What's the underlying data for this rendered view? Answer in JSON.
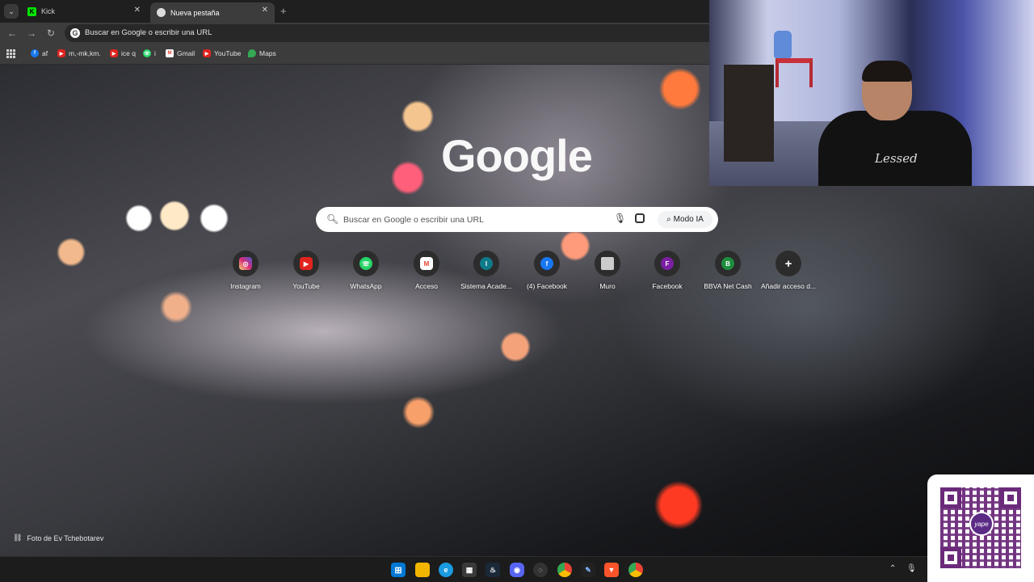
{
  "tabs": [
    {
      "title": "Kick",
      "active": false
    },
    {
      "title": "Nueva pestaña",
      "active": true
    }
  ],
  "omnibox": {
    "text": "Buscar en Google o escribir una URL"
  },
  "bookmarks": [
    {
      "label": "af",
      "icon": "facebook-icon",
      "color": "#1877f2"
    },
    {
      "label": "m,-mk,km.",
      "icon": "youtube-icon",
      "color": "#e0231e"
    },
    {
      "label": "ice q",
      "icon": "youtube-icon",
      "color": "#e0231e"
    },
    {
      "label": "i",
      "icon": "whatsapp-icon",
      "color": "#25d366"
    },
    {
      "label": "Gmail",
      "icon": "gmail-icon",
      "color": "#ea4335"
    },
    {
      "label": "YouTube",
      "icon": "youtube-icon",
      "color": "#e0231e"
    },
    {
      "label": "Maps",
      "icon": "maps-icon",
      "color": "#34a853"
    }
  ],
  "google": {
    "logo": "Google",
    "search_placeholder": "Buscar en Google o escribir una URL",
    "ai_mode_label": "Modo IA"
  },
  "shortcuts": [
    {
      "label": "Instagram",
      "icon": "instagram-icon",
      "color": "#d62976",
      "glyph": ""
    },
    {
      "label": "YouTube",
      "icon": "youtube-icon",
      "color": "#e0231e",
      "glyph": "▶"
    },
    {
      "label": "WhatsApp",
      "icon": "whatsapp-icon",
      "color": "#25d366",
      "glyph": ""
    },
    {
      "label": "Acceso",
      "icon": "gmail-icon",
      "color": "#ea4335",
      "glyph": "M"
    },
    {
      "label": "Sistema Acade...",
      "icon": "letter-i-icon",
      "color": "#0e7a8a",
      "glyph": "I"
    },
    {
      "label": "(4) Facebook",
      "icon": "facebook-icon",
      "color": "#1877f2",
      "glyph": "f"
    },
    {
      "label": "Muro",
      "icon": "muro-icon",
      "color": "#cccccc",
      "glyph": ""
    },
    {
      "label": "Facebook",
      "icon": "letter-f-icon",
      "color": "#7b1fa2",
      "glyph": "F"
    },
    {
      "label": "BBVA Net Cash",
      "icon": "letter-b-icon",
      "color": "#1e8e3e",
      "glyph": "B"
    },
    {
      "label": "Añadir acceso d...",
      "icon": "add-icon",
      "color": "#2c2c2c",
      "glyph": "+"
    }
  ],
  "photo_credit": "Foto de Ev Tchebotarev",
  "webcam": {
    "shirt_text": "Lessed"
  },
  "qr": {
    "brand": "yape"
  }
}
